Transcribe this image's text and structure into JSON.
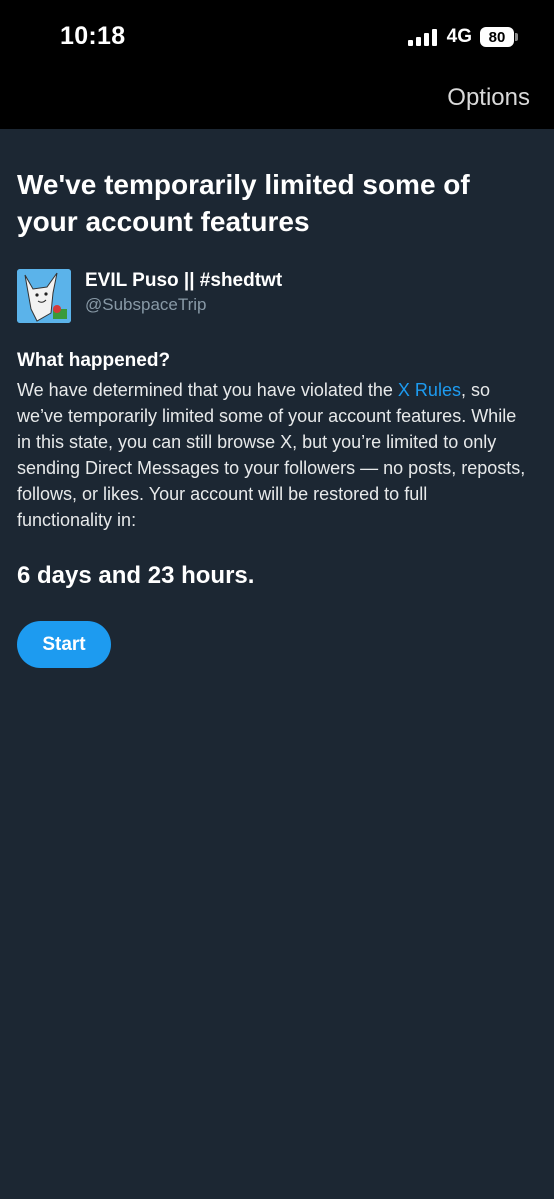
{
  "status_bar": {
    "time": "10:18",
    "network": "4G",
    "battery": "80"
  },
  "header": {
    "options_label": "Options"
  },
  "main": {
    "title": "We've temporarily limited some of your account features",
    "account": {
      "display_name": "EVIL Puso || #shedtwt",
      "handle": "@SubspaceTrip",
      "avatar_icon": "avatar-cartoon-icon"
    },
    "what_happened_title": "What happened?",
    "body_before_link": "We have determined that you have violated the ",
    "body_link": "X Rules",
    "body_after_link": ", so we’ve temporarily limited some of your account features. While in this state, you can still browse X, but you’re limited to only sending Direct Messages to your followers — no posts, reposts, follows, or likes. Your account will be restored to full functionality in:",
    "duration": "6 days and 23 hours.",
    "start_button": "Start"
  },
  "colors": {
    "background": "#1c2733",
    "accent": "#1d9bf0",
    "secondary_text": "#8899a6"
  }
}
